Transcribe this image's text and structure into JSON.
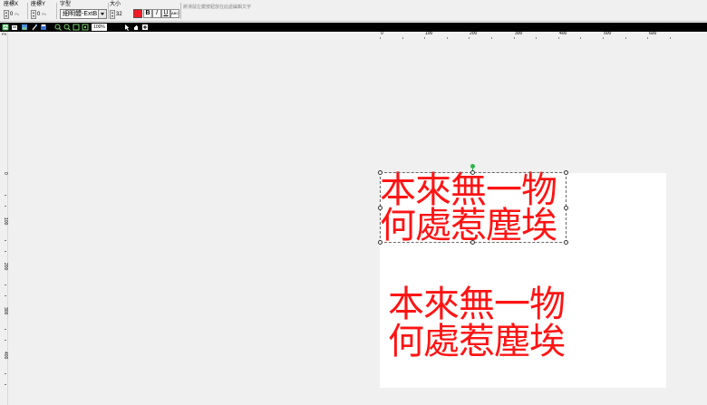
{
  "toolbar": {
    "x_label": "座標X",
    "x_value": "0",
    "y_label": "座標Y",
    "y_value": "0",
    "unit": "Px",
    "font_label": "字型",
    "font_value": "細明體-ExtB",
    "size_label": "大小",
    "size_value": "32",
    "bold": "B",
    "italic": "I",
    "underline": "U",
    "abc": "ABC",
    "text_placeholder": "將滑鼠左鍵按鈕放在此處編輯文字",
    "text_color": "#ee1c25"
  },
  "tbar": {
    "zoom": "100%",
    "icons": [
      "new-icon",
      "open-icon",
      "image-icon",
      "magic-icon",
      "save-icon",
      "zoom-in-icon",
      "zoom-out-icon",
      "fit-icon",
      "actual-size-icon",
      "pointer-icon",
      "hand-icon",
      "add-icon"
    ]
  },
  "ruler": {
    "corner": "PX",
    "h": [
      "0",
      "100",
      "200",
      "300",
      "400",
      "500",
      "600"
    ],
    "v": [
      "0",
      "100",
      "200",
      "300",
      "400"
    ]
  },
  "canvas": {
    "line1": "本來無一物",
    "line2": "何處惹塵埃",
    "shadow_line1": "本來無一物",
    "shadow_line2": "何處惹塵埃",
    "text_color": "#ff1414",
    "selection_handle_color": "#2fb24a"
  }
}
